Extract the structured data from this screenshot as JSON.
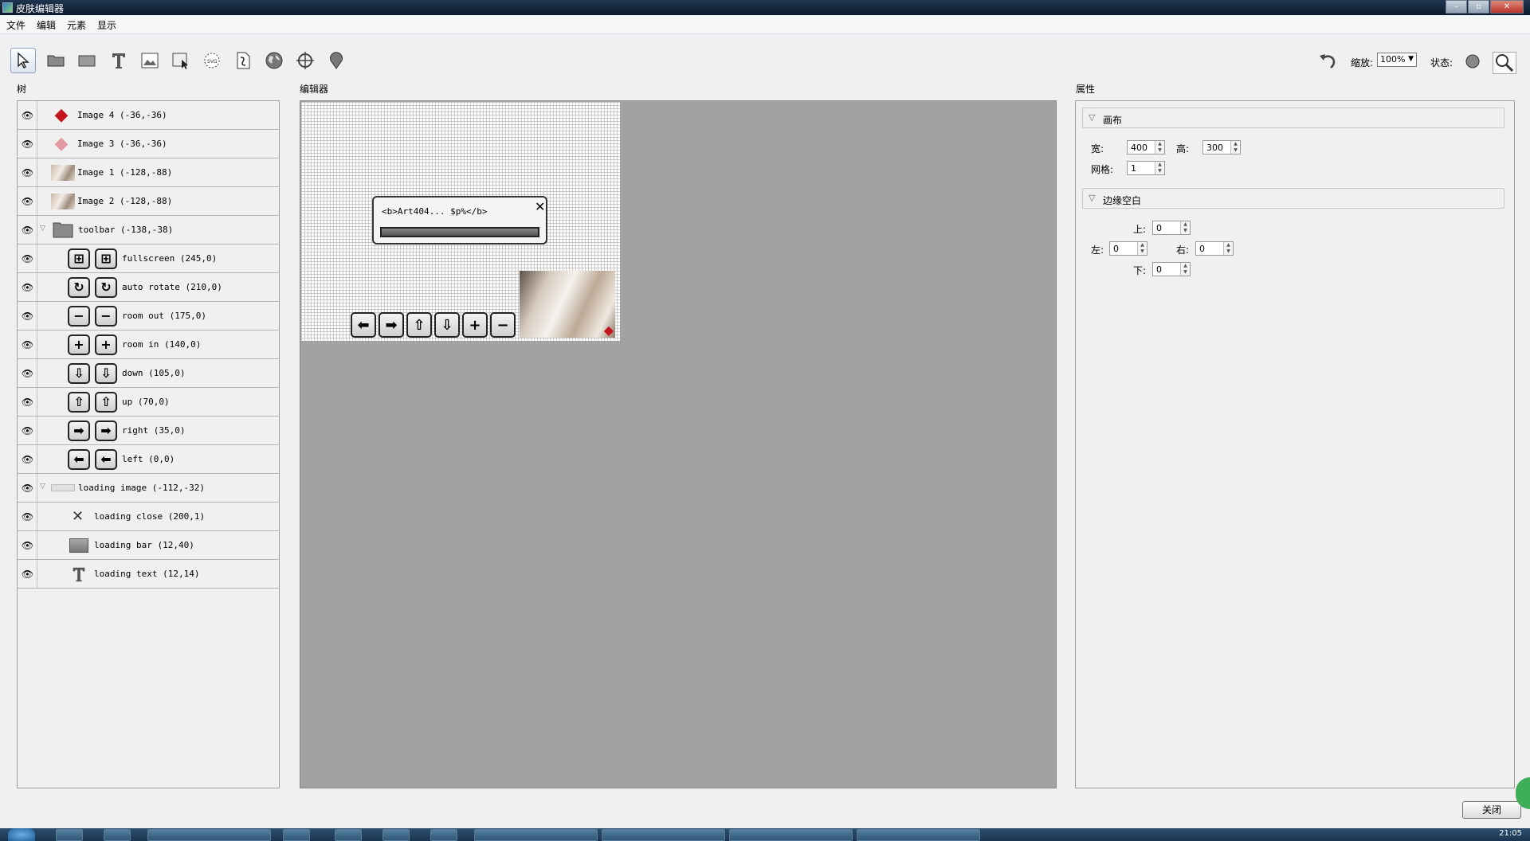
{
  "window": {
    "title": "皮肤编辑器"
  },
  "menu": [
    "文件",
    "编辑",
    "元素",
    "显示"
  ],
  "toolbar": {
    "tools": [
      "select-tool-icon",
      "folder-tool-icon",
      "rectangle-tool-icon",
      "text-tool-icon",
      "image-tool-icon",
      "cursor-image-tool-icon",
      "svg-tool-icon",
      "script-tool-icon",
      "globe-tool-icon",
      "crosshair-tool-icon",
      "marker-tool-icon"
    ],
    "zoom_label": "缩放:",
    "zoom_value": "100%",
    "state_label": "状态:"
  },
  "tree": {
    "label": "树",
    "rows": [
      {
        "label": "Image 4 (-36,-36)"
      },
      {
        "label": "Image 3 (-36,-36)"
      },
      {
        "label": "Image 1 (-128,-88)"
      },
      {
        "label": "Image 2 (-128,-88)"
      },
      {
        "label": "toolbar (-138,-38)"
      },
      {
        "label": "fullscreen (245,0)"
      },
      {
        "label": "auto rotate (210,0)"
      },
      {
        "label": "room out (175,0)"
      },
      {
        "label": "room in (140,0)"
      },
      {
        "label": "down (105,0)"
      },
      {
        "label": "up (70,0)"
      },
      {
        "label": "right (35,0)"
      },
      {
        "label": "left (0,0)"
      },
      {
        "label": "loading image (-112,-32)"
      },
      {
        "label": "loading close (200,1)"
      },
      {
        "label": "loading bar (12,40)"
      },
      {
        "label": "loading text (12,14)"
      }
    ]
  },
  "editor": {
    "label": "编辑器",
    "loading_text": "<b>Art404... $p%</b>"
  },
  "properties": {
    "label": "属性",
    "canvas_section": "画布",
    "width_label": "宽:",
    "width_value": "400",
    "height_label": "高:",
    "height_value": "300",
    "grid_label": "网格:",
    "grid_value": "1",
    "margin_section": "边缘空白",
    "top_label": "上:",
    "top_value": "0",
    "left_label": "左:",
    "left_value": "0",
    "right_label": "右:",
    "right_value": "0",
    "bottom_label": "下:",
    "bottom_value": "0"
  },
  "footer": {
    "close_label": "关闭"
  },
  "taskbar": {
    "clock": "21:05"
  }
}
